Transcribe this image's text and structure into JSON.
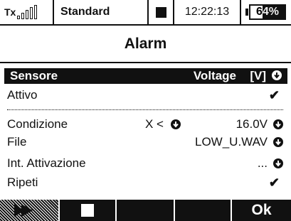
{
  "status": {
    "tx_label": "Tx",
    "model": "Standard",
    "time": "12:22:13",
    "battery_text": "64%",
    "battery_level": 0.64,
    "signal_bars": 0
  },
  "title": "Alarm",
  "header": {
    "label": "Sensore",
    "value": "Voltage",
    "unit": "[V]"
  },
  "rows": {
    "attivo": {
      "label": "Attivo",
      "check": "✔"
    },
    "condizione": {
      "label": "Condizione",
      "operator": "X <",
      "value": "16.0V"
    },
    "file": {
      "label": "File",
      "value": "LOW_U.WAV"
    },
    "int_attivazione": {
      "label": "Int. Attivazione",
      "value": "..."
    },
    "ripeti": {
      "label": "Ripeti",
      "check": "✔"
    }
  },
  "softkeys": {
    "sk5": "Ok"
  },
  "icons": {
    "arrow": "round-arrow-down-icon",
    "check": "checkmark-icon",
    "stop": "stop-square-icon",
    "play": "play-icon",
    "battery": "battery-icon",
    "signal": "signal-bars-icon"
  }
}
